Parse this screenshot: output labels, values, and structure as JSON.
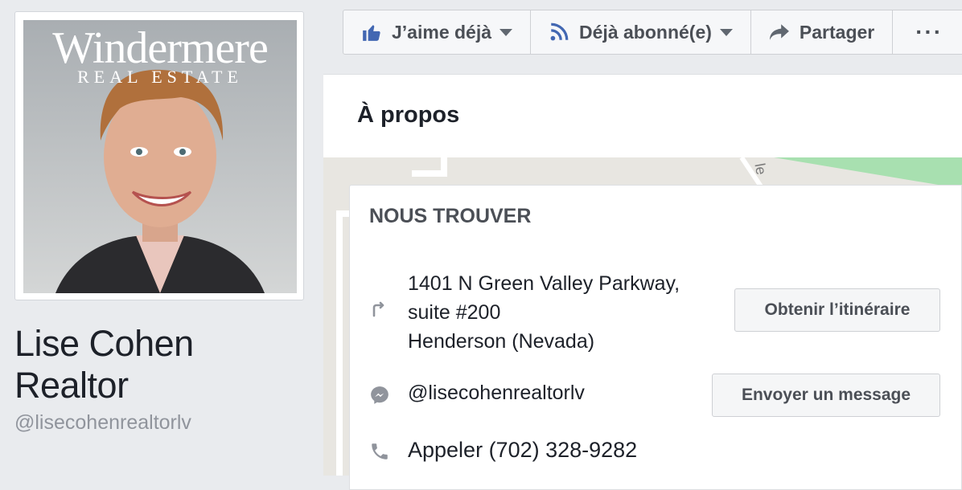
{
  "profile": {
    "brand_name": "Windermere",
    "brand_sub": "REAL ESTATE",
    "name": "Lise Cohen Realtor",
    "handle": "@lisecohenrealtorlv"
  },
  "actions": {
    "like_label": "J’aime déjà",
    "follow_label": "Déjà abonné(e)",
    "share_label": "Partager",
    "more_label": "···"
  },
  "about": {
    "title": "À propos"
  },
  "find_us": {
    "title": "NOUS TROUVER",
    "address_line1": "1401 N Green Valley Parkway,",
    "address_line2": "suite #200",
    "address_line3": "Henderson (Nevada)",
    "directions_button": "Obtenir l’itinéraire",
    "messenger_handle": "@lisecohenrealtorlv",
    "message_button": "Envoyer un message",
    "phone_text": "Appeler (702) 328-9282"
  },
  "colors": {
    "facebook_blue": "#4267b2",
    "icon_gray": "#90949c",
    "background": "#e9ebee"
  }
}
